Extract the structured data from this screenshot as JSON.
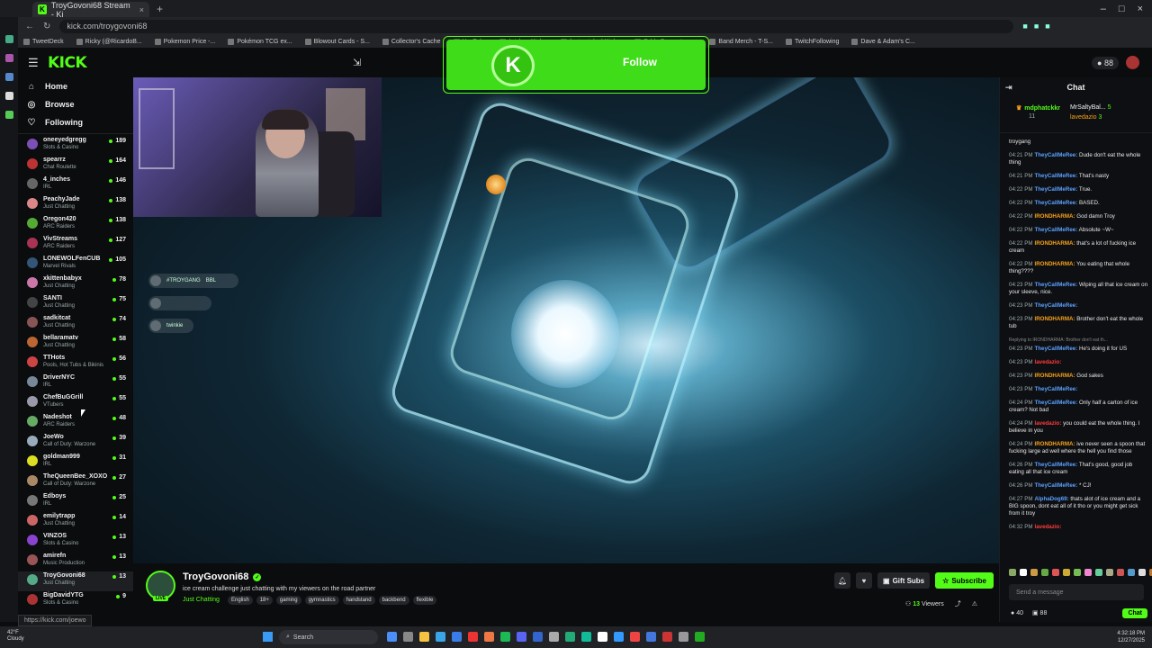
{
  "browser": {
    "tab_title": "TroyGovoni68 Stream - Ki",
    "url": "kick.com/troygovoni68",
    "bookmarks": [
      "TweetDeck",
      "Ricky (@RicardoB...",
      "Pokemon Price -...",
      "Pokémon TCG ex...",
      "Blowout Cards - S...",
      "Collector's Cache",
      "YouTube",
      "/rricky - Kick...",
      "fuzionricky | Kick...",
      "Odds Converter -...",
      "Band Merch - T-S...",
      "TwitchFollowing",
      "Dave & Adam's C..."
    ],
    "status_url": "https://kick.com/joewo"
  },
  "header": {
    "logo": "KICK",
    "points": "88"
  },
  "follow_overlay": {
    "label": "Follow",
    "k": "K"
  },
  "nav": {
    "home": "Home",
    "browse": "Browse",
    "following": "Following"
  },
  "channels": [
    {
      "name": "oneeyedgregg",
      "cat": "Slots & Casino",
      "viewers": "189",
      "color": "#7b4fb5"
    },
    {
      "name": "spearrz",
      "cat": "Chat Roulette",
      "viewers": "164",
      "color": "#b33"
    },
    {
      "name": "4_inches",
      "cat": "IRL",
      "viewers": "146",
      "color": "#666"
    },
    {
      "name": "PeachyJade",
      "cat": "Just Chatting",
      "viewers": "138",
      "color": "#d88"
    },
    {
      "name": "Oregon420",
      "cat": "ARC Raiders",
      "viewers": "138",
      "color": "#5a3"
    },
    {
      "name": "VivStreams",
      "cat": "ARC Raiders",
      "viewers": "127",
      "color": "#a35"
    },
    {
      "name": "LONEWOLFenCUB",
      "cat": "Marvel Rivals",
      "viewers": "105",
      "color": "#357"
    },
    {
      "name": "xkittenbabyx",
      "cat": "Just Chatting",
      "viewers": "78",
      "color": "#c7a"
    },
    {
      "name": "SANTI",
      "cat": "Just Chatting",
      "viewers": "75",
      "color": "#444"
    },
    {
      "name": "sadkitcat",
      "cat": "Just Chatting",
      "viewers": "74",
      "color": "#855"
    },
    {
      "name": "bellaramatv",
      "cat": "Just Chatting",
      "viewers": "58",
      "color": "#b63"
    },
    {
      "name": "TTHots",
      "cat": "Pools, Hot Tubs & Bikinis",
      "viewers": "56",
      "color": "#c44"
    },
    {
      "name": "DriverNYC",
      "cat": "IRL",
      "viewers": "55",
      "color": "#789"
    },
    {
      "name": "ChefBuGGrill",
      "cat": "VTubers",
      "viewers": "55",
      "color": "#99a"
    },
    {
      "name": "Nadeshot",
      "cat": "ARC Raiders",
      "viewers": "48",
      "color": "#6a6"
    },
    {
      "name": "JoeWo",
      "cat": "Call of Duty: Warzone",
      "viewers": "39",
      "color": "#9ab"
    },
    {
      "name": "goldman999",
      "cat": "IRL",
      "viewers": "31",
      "color": "#dd2"
    },
    {
      "name": "TheQueenBee_XOXO",
      "cat": "Call of Duty: Warzone",
      "viewers": "27",
      "color": "#a86"
    },
    {
      "name": "Edboys",
      "cat": "IRL",
      "viewers": "25",
      "color": "#777"
    },
    {
      "name": "emilytrapp",
      "cat": "Just Chatting",
      "viewers": "14",
      "color": "#c66"
    },
    {
      "name": "VINZOS",
      "cat": "Slots & Casino",
      "viewers": "13",
      "color": "#84c"
    },
    {
      "name": "amirefn",
      "cat": "Music Production",
      "viewers": "13",
      "color": "#955"
    },
    {
      "name": "TroyGovoni68",
      "cat": "Just Chatting",
      "viewers": "13",
      "color": "#5a8"
    },
    {
      "name": "BigDavidYTG",
      "cat": "Slots & Casino",
      "viewers": "9",
      "color": "#a33"
    }
  ],
  "video_votes": [
    "#TROYGANG",
    "BBL",
    "twinkie"
  ],
  "stream": {
    "name": "TroyGovoni68",
    "title": "ice cream challenge just chatting with my viewers on the road partner",
    "category": "Just Chatting",
    "tags": [
      "English",
      "18+",
      "gaming",
      "gymnastics",
      "handstand",
      "backbend",
      "flexible"
    ],
    "gift_label": "Gift Subs",
    "subscribe_label": "Subscribe",
    "viewers_count": "13",
    "viewers_label": "Viewers",
    "live_badge": "LIVE"
  },
  "chat": {
    "title": "Chat",
    "pinned_user": "mdphatckkr",
    "pinned_count": "11",
    "pin_user2": "MrSaltyBal...",
    "pin_user3": "lavedazio",
    "pin_val2": "5",
    "pin_val3": "3",
    "first_line": "troygang",
    "messages": [
      {
        "t": "04:21 PM",
        "u": "TheyCallMeRee:",
        "c": "#5aa0ff",
        "m": "Dude don't eat the whole thing"
      },
      {
        "t": "04:21 PM",
        "u": "TheyCallMeRee:",
        "c": "#5aa0ff",
        "m": "That's nasty"
      },
      {
        "t": "04:22 PM",
        "u": "TheyCallMeRee:",
        "c": "#5aa0ff",
        "m": "True."
      },
      {
        "t": "04:22 PM",
        "u": "TheyCallMeRee:",
        "c": "#5aa0ff",
        "m": "BASED."
      },
      {
        "t": "04:22 PM",
        "u": "IRONDHARMA:",
        "c": "#f7a21b",
        "m": "God damn Troy"
      },
      {
        "t": "04:22 PM",
        "u": "TheyCallMeRee:",
        "c": "#5aa0ff",
        "m": "Absolute ~W~"
      },
      {
        "t": "04:22 PM",
        "u": "IRONDHARMA:",
        "c": "#f7a21b",
        "m": "that's a lot of fucking ice cream"
      },
      {
        "t": "04:22 PM",
        "u": "IRONDHARMA:",
        "c": "#f7a21b",
        "m": "You eating that whole thing????"
      },
      {
        "t": "04:23 PM",
        "u": "TheyCallMeRee:",
        "c": "#5aa0ff",
        "m": "Wiping all that ice cream on your sleeve, nice."
      },
      {
        "t": "04:23 PM",
        "u": "TheyCallMeRee:",
        "c": "#5aa0ff",
        "m": ""
      },
      {
        "t": "04:23 PM",
        "u": "IRONDHARMA:",
        "c": "#f7a21b",
        "m": "Brother don't eat the whole tub"
      },
      {
        "t": "04:23 PM",
        "u": "TheyCallMeRee:",
        "c": "#5aa0ff",
        "m": "He's doing it for US"
      },
      {
        "t": "04:23 PM",
        "u": "lavedazio:",
        "c": "#ff3b3b",
        "m": ""
      },
      {
        "t": "04:23 PM",
        "u": "IRONDHARMA:",
        "c": "#f7a21b",
        "m": "God sakes"
      },
      {
        "t": "04:23 PM",
        "u": "TheyCallMeRee:",
        "c": "#5aa0ff",
        "m": ""
      },
      {
        "t": "04:24 PM",
        "u": "TheyCallMeRee:",
        "c": "#5aa0ff",
        "m": "Only half a carton of ice cream? Not bad"
      },
      {
        "t": "04:24 PM",
        "u": "lavedazio:",
        "c": "#ff3b3b",
        "m": "you could eat the whole thing. I believe in you"
      },
      {
        "t": "04:24 PM",
        "u": "IRONDHARMA:",
        "c": "#f7a21b",
        "m": "ive never seen a spoon that fucking large ad well where the hell you find those"
      },
      {
        "t": "04:26 PM",
        "u": "TheyCallMeRee:",
        "c": "#5aa0ff",
        "m": "That's good, good job eating all that ice cream"
      },
      {
        "t": "04:26 PM",
        "u": "TheyCallMeRee:",
        "c": "#5aa0ff",
        "m": "* CJ!"
      },
      {
        "t": "04:27 PM",
        "u": "AlphaDog69:",
        "c": "#5aa0ff",
        "m": "thats alot of ice cream and a BIG spoon, dont eat all of it tho or you might get sick from it troy"
      },
      {
        "t": "04:32 PM",
        "u": "lavedazio:",
        "c": "#ff3b3b",
        "m": ""
      }
    ],
    "reply_hint": "Replying to IRONDHARMA: Brother don't eat th...",
    "input_placeholder": "Send a message",
    "points": "40",
    "viewers": "88",
    "chat_button": "Chat"
  },
  "taskbar": {
    "temp": "42°F",
    "weather": "Cloudy",
    "search": "Search",
    "time": "4:32:18 PM",
    "date": "12/27/2025"
  }
}
